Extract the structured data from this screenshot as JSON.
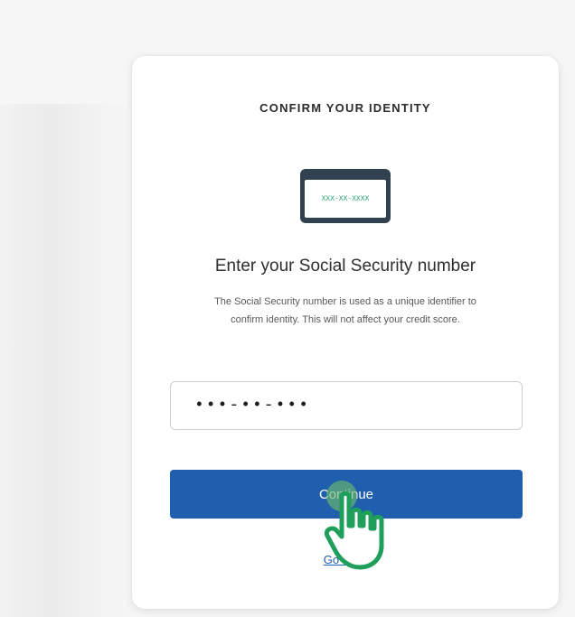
{
  "card": {
    "eyebrow": "CONFIRM YOUR IDENTITY",
    "card_icon_mask": "XXX-XX-XXXX",
    "heading": "Enter your Social Security number",
    "description": "The Social Security number is used as a unique identifier to confirm identity. This will not affect your credit score.",
    "ssn_input_value": "•••-••-•••",
    "continue_label": "Continue",
    "go_back_label": "Go back"
  },
  "colors": {
    "primary": "#1f5fae",
    "icon_dark": "#32414f",
    "cursor_green": "#23a36a"
  },
  "icons": {
    "card": "ssn-card-icon",
    "cursor": "pointing-hand-cursor-icon"
  }
}
